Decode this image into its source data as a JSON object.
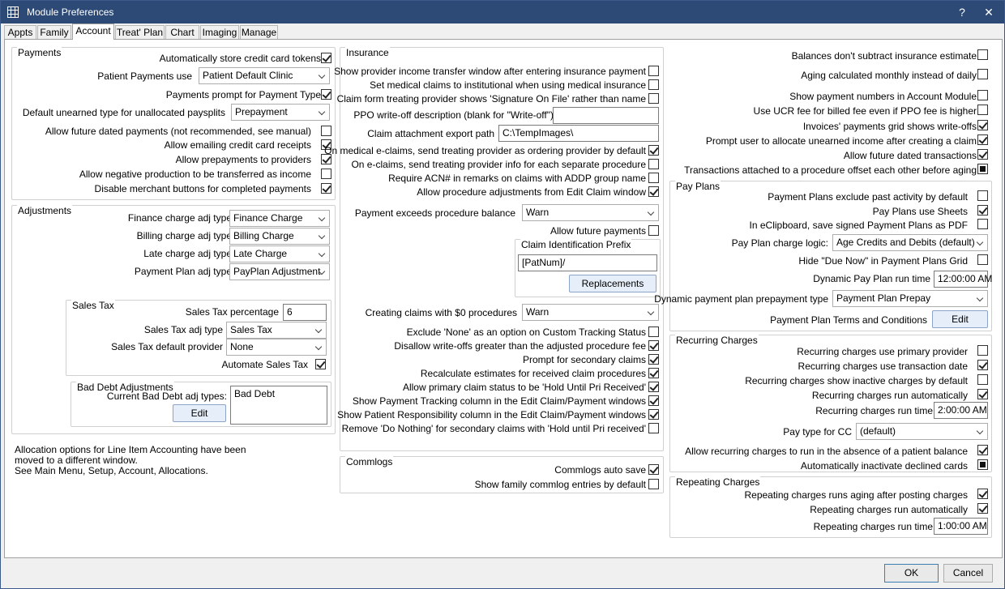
{
  "window": {
    "title": "Module Preferences",
    "help": "?",
    "close": "✕"
  },
  "tabs": [
    "Appts",
    "Family",
    "Account",
    "Treat' Plan",
    "Chart",
    "Imaging",
    "Manage"
  ],
  "payments": {
    "title": "Payments",
    "auto_store": "Automatically store credit card tokens",
    "patient_payments_use": "Patient Payments use",
    "patient_payments_value": "Patient Default Clinic",
    "prompt_type": "Payments prompt for Payment Type",
    "default_unearned": "Default unearned type for unallocated paysplits",
    "default_unearned_value": "Prepayment",
    "future_dated": "Allow future dated payments (not recommended, see manual)",
    "emailing": "Allow emailing credit card receipts",
    "prepayments": "Allow prepayments to providers",
    "negative": "Allow negative production to be transferred as income",
    "disable_merchant": "Disable merchant buttons for completed payments"
  },
  "adjustments": {
    "title": "Adjustments",
    "finance_label": "Finance charge adj type",
    "finance_value": "Finance Charge",
    "billing_label": "Billing charge adj type",
    "billing_value": "Billing Charge",
    "late_label": "Late charge adj type",
    "late_value": "Late Charge",
    "payplan_label": "Payment Plan adj type",
    "payplan_value": "PayPlan Adjustment"
  },
  "sales_tax": {
    "title": "Sales Tax",
    "pct_label": "Sales Tax percentage",
    "pct_value": "6",
    "adj_label": "Sales Tax adj type",
    "adj_value": "Sales Tax",
    "prov_label": "Sales Tax default provider",
    "prov_value": "None",
    "automate": "Automate Sales Tax"
  },
  "bad_debt": {
    "title": "Bad Debt Adjustments",
    "current_label": "Current Bad Debt adj types:",
    "edit": "Edit",
    "list_item": "Bad Debt"
  },
  "alloc_note": {
    "line1": "Allocation options for Line Item Accounting have been",
    "line2": "moved to a different window.",
    "line3": "See Main Menu, Setup, Account, Allocations."
  },
  "insurance": {
    "title": "Insurance",
    "income_transfer": "Show provider income transfer window after entering insurance payment",
    "institutional": "Set medical claims to institutional when using medical insurance",
    "signature": "Claim form treating provider shows 'Signature On File' rather than name",
    "ppo_label": "PPO write-off description (blank for \"Write-off\")",
    "ppo_value": "",
    "attach_label": "Claim attachment export path",
    "attach_value": "C:\\TempImages\\",
    "ordering": "On medical e-claims, send treating provider as ordering provider by default",
    "separate": "On e-claims, send treating provider info for each separate procedure",
    "acn": "Require ACN# in remarks on claims with ADDP group name",
    "proc_adj": "Allow procedure adjustments from Edit Claim window",
    "exceeds_label": "Payment exceeds procedure balance",
    "exceeds_value": "Warn",
    "future_payments": "Allow future payments",
    "prefix_title": "Claim Identification Prefix",
    "prefix_value": "[PatNum]/",
    "replacements": "Replacements",
    "zero_label": "Creating claims with $0 procedures",
    "zero_value": "Warn",
    "exclude_none": "Exclude 'None' as an option on Custom Tracking Status",
    "disallow_wo": "Disallow write-offs greater than the adjusted procedure fee",
    "prompt_secondary": "Prompt for secondary claims",
    "recalc": "Recalculate estimates for received claim procedures",
    "hold_until": "Allow primary claim status to be 'Hold Until Pri Received'",
    "tracking_col": "Show Payment Tracking column in the Edit Claim/Payment windows",
    "resp_col": "Show Patient Responsibility column in the Edit Claim/Payment windows",
    "remove_nothing": "Remove 'Do Nothing' for secondary claims with 'Hold until Pri received'"
  },
  "commlogs": {
    "title": "Commlogs",
    "auto_save": "Commlogs auto save",
    "family": "Show family commlog entries by default"
  },
  "right_top": {
    "balances": "Balances don't subtract insurance estimate",
    "aging": "Aging calculated monthly instead of daily",
    "pay_numbers": "Show payment numbers in Account Module",
    "ucr": "Use UCR fee for billed fee even if PPO fee is higher",
    "invoices": "Invoices' payments grid shows write-offs",
    "prompt_unearned": "Prompt user to allocate unearned income after creating a claim",
    "future_trans": "Allow future dated transactions",
    "offset": "Transactions attached to a procedure offset each other before aging"
  },
  "pay_plans": {
    "title": "Pay Plans",
    "exclude_past": "Payment Plans exclude past activity by default",
    "use_sheets": "Pay Plans use Sheets",
    "eclipboard": "In eClipboard, save signed Payment Plans as PDF",
    "logic_label": "Pay Plan charge logic:",
    "logic_value": "Age Credits and Debits (default)",
    "hide_due": "Hide \"Due Now\" in Payment Plans Grid",
    "runtime_label": "Dynamic Pay Plan run time",
    "runtime_value": "12:00:00 AM",
    "prepay_label": "Dynamic payment plan prepayment type",
    "prepay_value": "Payment Plan Prepay",
    "terms_label": "Payment Plan Terms and Conditions",
    "edit": "Edit"
  },
  "recurring": {
    "title": "Recurring Charges",
    "primary_prov": "Recurring charges use primary provider",
    "trans_date": "Recurring charges use transaction date",
    "inactive": "Recurring charges show inactive charges by default",
    "auto": "Recurring charges run automatically",
    "runtime_label": "Recurring charges run time",
    "runtime_value": "2:00:00 AM",
    "paytype_label": "Pay type for CC",
    "paytype_value": "(default)",
    "absence": "Allow recurring charges to run in the absence of a patient balance",
    "inactivate": "Automatically inactivate declined cards"
  },
  "repeating": {
    "title": "Repeating Charges",
    "aging": "Repeating charges runs aging after posting charges",
    "auto": "Repeating charges run automatically",
    "runtime_label": "Repeating charges run time",
    "runtime_value": "1:00:00 AM"
  },
  "footer": {
    "ok": "OK",
    "cancel": "Cancel"
  }
}
